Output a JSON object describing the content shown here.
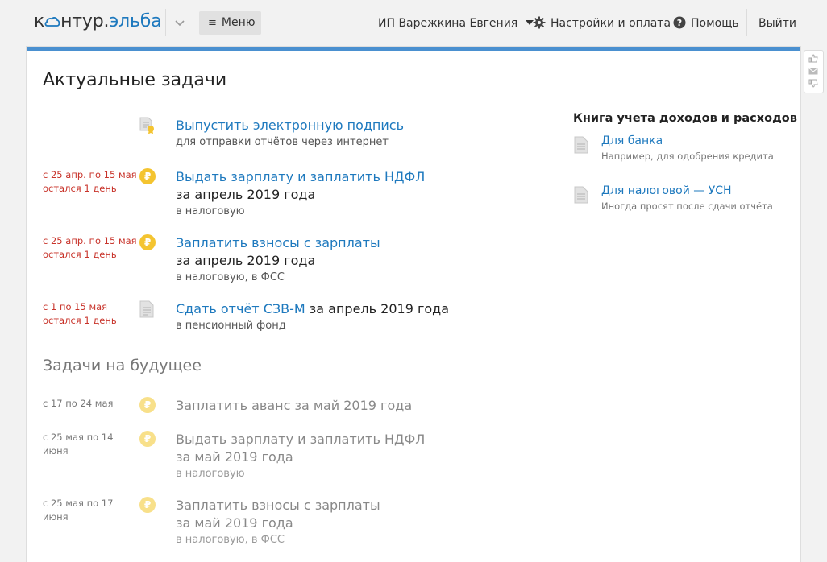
{
  "header": {
    "logo_text": "к",
    "logo_rest": "нтур.",
    "logo_brand": "эльба",
    "menu_label": "Меню",
    "user_label": "ИП Варежкина Евгения",
    "settings_label": "Настройки и оплата",
    "help_label": "Помощь",
    "exit_label": "Выйти"
  },
  "main": {
    "title": "Актуальные задачи",
    "future_title": "Задачи на будущее"
  },
  "current_tasks": [
    {
      "date1": "",
      "date2": "",
      "icon": "certificate-icon",
      "link": "Выпустить электронную подпись",
      "after_link": "",
      "line2": "",
      "sub": "для отправки отчётов через интернет"
    },
    {
      "date1": "с 25 апр. по 15 мая",
      "date2": "остался 1 день",
      "icon": "ruble-icon",
      "link": "Выдать зарплату и заплатить НДФЛ",
      "after_link": "",
      "line2": "за апрель 2019 года",
      "sub": "в налоговую"
    },
    {
      "date1": "с 25 апр. по 15 мая",
      "date2": "остался 1 день",
      "icon": "ruble-icon",
      "link": "Заплатить взносы с зарплаты",
      "after_link": "",
      "line2": "за апрель 2019 года",
      "sub": "в налоговую, в ФСС"
    },
    {
      "date1": "с 1 по 15 мая",
      "date2": "остался 1 день",
      "icon": "document-icon",
      "link": "Сдать отчёт СЗВ-М",
      "after_link": " за апрель 2019 года",
      "line2": "",
      "sub": "в пенсионный фонд"
    }
  ],
  "future_tasks": [
    {
      "date": "с 17 по 24 мая",
      "icon": "ruble-icon",
      "title": "Заплатить аванс за май 2019 года",
      "line2": "",
      "sub": ""
    },
    {
      "date": "с 25 мая по 14 июня",
      "icon": "ruble-icon",
      "title": "Выдать зарплату и заплатить НДФЛ",
      "line2": "за май 2019 года",
      "sub": "в налоговую"
    },
    {
      "date": "с 25 мая по 17 июня",
      "icon": "ruble-icon",
      "title": "Заплатить взносы с зарплаты",
      "line2": "за май 2019 года",
      "sub": "в налоговую, в ФСС"
    }
  ],
  "sidebar": {
    "title": "Книга учета доходов и расходов",
    "items": [
      {
        "link": "Для банка",
        "hint": "Например, для одобрения кредита"
      },
      {
        "link": "Для налоговой — УСН",
        "hint": "Иногда просят после сдачи отчёта"
      }
    ]
  },
  "ruble_symbol": "₽",
  "colors": {
    "accent": "#1e79be",
    "deadline": "#c8332a",
    "ruble": "#f4c430",
    "bar": "#4a90d0"
  }
}
